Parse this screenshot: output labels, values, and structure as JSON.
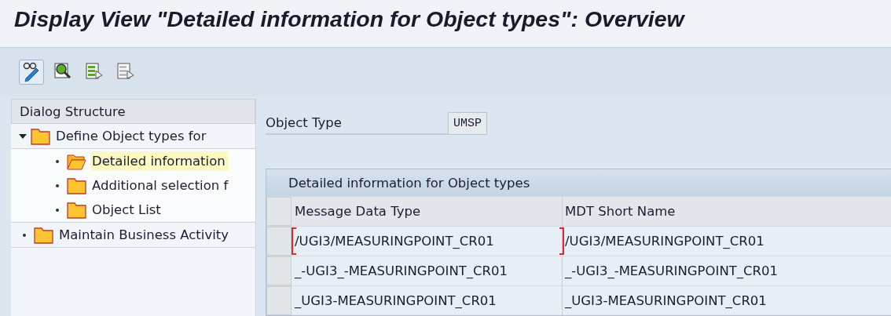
{
  "window": {
    "title": "Display View \"Detailed information for Object types\": Overview"
  },
  "toolbar": {
    "buttons": [
      {
        "kind": "display-change",
        "selected": true
      },
      {
        "kind": "find",
        "selected": false
      },
      {
        "kind": "select-all",
        "selected": false
      },
      {
        "kind": "deselect-all",
        "selected": false
      }
    ]
  },
  "dialog_structure": {
    "title": "Dialog Structure",
    "items": [
      {
        "label": "Define Object types for",
        "expanded": true,
        "selected": false,
        "children": [
          {
            "label": "Detailed information",
            "selected": true
          },
          {
            "label": "Additional selection f",
            "selected": false
          },
          {
            "label": "Object List",
            "selected": false
          }
        ]
      },
      {
        "label": "Maintain Business Activity",
        "selected": false
      }
    ]
  },
  "object_type": {
    "label": "Object Type",
    "value": "UMSP"
  },
  "table": {
    "title": "Detailed information for Object types",
    "columns": [
      "Message Data Type",
      "MDT Short Name"
    ],
    "rows": [
      {
        "cells": [
          "/UGI3/MEASURINGPOINT_CR01",
          "/UGI3/MEASURINGPOINT_CR01"
        ],
        "focused": true
      },
      {
        "cells": [
          "_-UGI3_-MEASURINGPOINT_CR01",
          "_-UGI3_-MEASURINGPOINT_CR01"
        ],
        "focused": false
      },
      {
        "cells": [
          "_UGI3-MEASURINGPOINT_CR01",
          "_UGI3-MEASURINGPOINT_CR01"
        ],
        "focused": false
      }
    ]
  }
}
